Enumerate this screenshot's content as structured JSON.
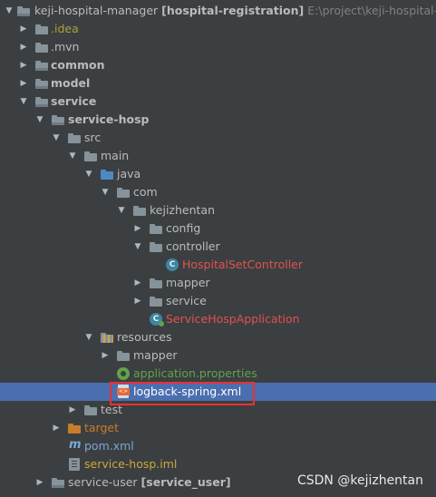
{
  "tree": {
    "root": {
      "name": "keji-hospital-manager",
      "module": "[hospital-registration]",
      "path": "E:\\project\\keji-hospital-manag"
    },
    "idea": ".idea",
    "mvn": ".mvn",
    "common": "common",
    "model": "model",
    "service": "service",
    "service_hosp": "service-hosp",
    "src": "src",
    "main": "main",
    "java": "java",
    "com": "com",
    "kejizhentan": "kejizhentan",
    "config": "config",
    "controller": "controller",
    "hospital_set_controller": "HospitalSetController",
    "mapper": "mapper",
    "service_pkg": "service",
    "service_hosp_application": "ServiceHospApplication",
    "resources": "resources",
    "resources_mapper": "mapper",
    "application_properties": "application.properties",
    "logback_spring": "logback-spring.xml",
    "test": "test",
    "target": "target",
    "pom": "pom.xml",
    "iml": "service-hosp.iml",
    "service_user": {
      "name": "service-user",
      "module": "[service_user]"
    }
  },
  "icons": {
    "class": "C",
    "folder": "folder-icon",
    "xml": "xml-file-icon",
    "maven": "maven-m-icon"
  },
  "colors": {
    "background": "#3c3f41",
    "selection": "#4b6eaf",
    "highlight_border": "#e8312e",
    "modified_red": "#e0524e",
    "resource_green": "#5fa44a"
  },
  "watermark": "CSDN @kejizhentan"
}
